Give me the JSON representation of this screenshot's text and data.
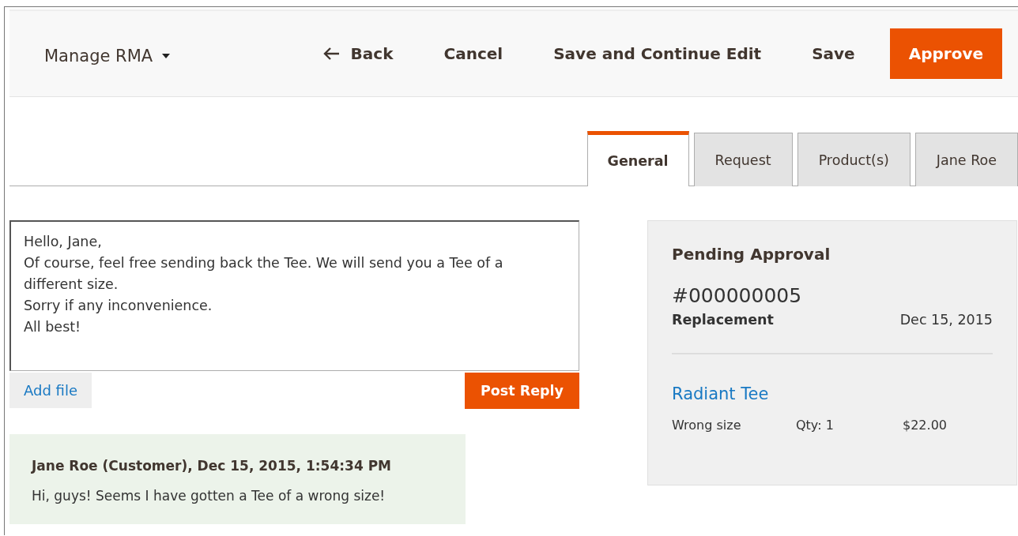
{
  "header": {
    "menu": "Manage RMA",
    "actions": [
      {
        "label": "Back",
        "kind": "back"
      },
      {
        "label": "Cancel",
        "kind": "plain"
      },
      {
        "label": "Save and Continue Edit",
        "kind": "plain"
      },
      {
        "label": "Save",
        "kind": "plain"
      },
      {
        "label": "Approve",
        "kind": "primary"
      }
    ]
  },
  "tabs": [
    {
      "label": "General",
      "selected": true
    },
    {
      "label": "Request",
      "selected": false
    },
    {
      "label": "Product(s)",
      "selected": false
    },
    {
      "label": "Jane Roe",
      "selected": false
    }
  ],
  "reply": {
    "value": "Hello, Jane,\nOf course, feel free sending back the Tee. We will send you a Tee of a different size.\nSorry if any inconvenience.\nAll best!",
    "add_file": "Add file",
    "post": "Post Reply"
  },
  "messages": [
    {
      "author": "Jane Roe (Customer), Dec 15, 2015, 1:54:34 PM",
      "text": "Hi, guys! Seems I have gotten a Tee of a wrong size!"
    }
  ],
  "summary": {
    "status": "Pending Approval",
    "number": "#000000005",
    "type": "Replacement",
    "date": "Dec 15, 2015",
    "product": {
      "name": "Radiant Tee",
      "reason": "Wrong size",
      "qty": "Qty: 1",
      "price": "$22.00"
    }
  }
}
